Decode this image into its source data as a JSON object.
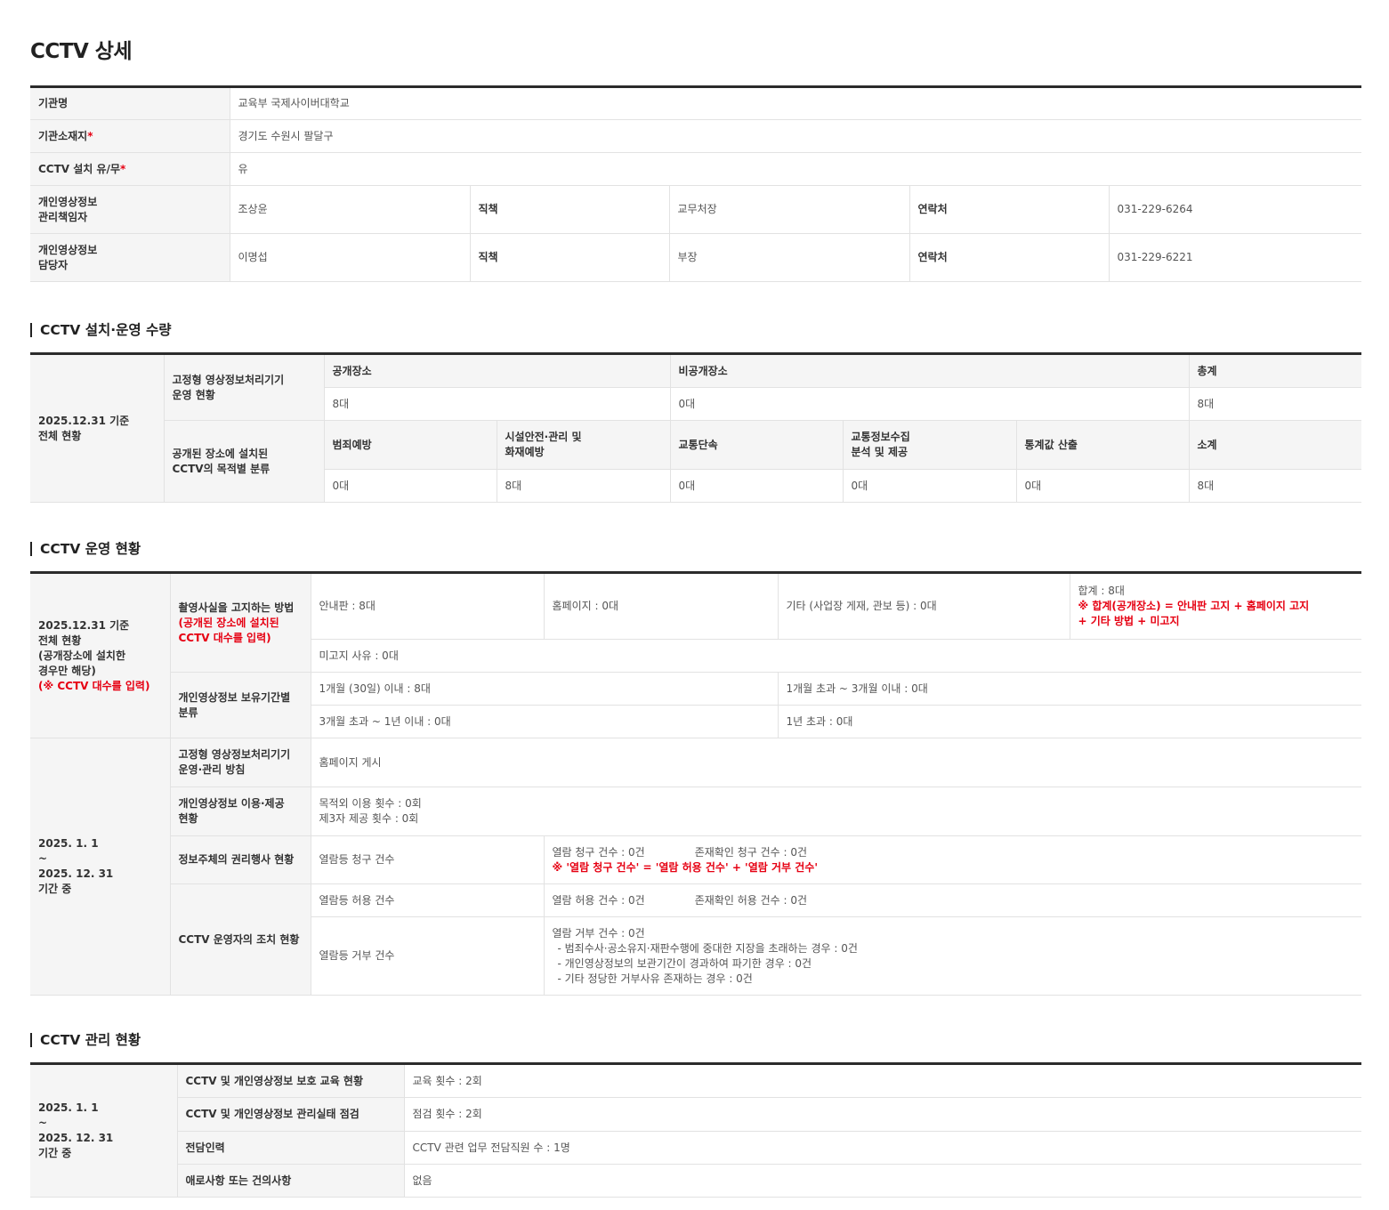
{
  "page_title": "CCTV 상세",
  "basic": {
    "agency_label": "기관명",
    "agency_value": "교육부 국제사이버대학교",
    "location_label": "기관소재지",
    "location_value": "경기도 수원시 팔달구",
    "install_label": "CCTV 설치 유/무",
    "install_value": "유",
    "required_mark": "*",
    "manager_label": [
      "개인영상정보",
      "관리책임자"
    ],
    "manager_name": "조상윤",
    "position_label": "직책",
    "manager_position": "교무처장",
    "contact_label": "연락처",
    "manager_contact": "031-229-6264",
    "staff_label": [
      "개인영상정보",
      "담당자"
    ],
    "staff_name": "이명섭",
    "staff_position": "부장",
    "staff_contact": "031-229-6221"
  },
  "install": {
    "section_title": "CCTV 설치·운영 수량",
    "date_label": [
      "2025.12.31 기준",
      "전체 현황"
    ],
    "fixed_label": [
      "고정형 영상정보처리기기",
      "운영 현황"
    ],
    "public_label": "공개장소",
    "nonpublic_label": "비공개장소",
    "total_label": "총계",
    "public_value": "8대",
    "nonpublic_value": "0대",
    "total_value": "8대",
    "purpose_label": [
      "공개된 장소에 설치된",
      "CCTV의 목적별 분류"
    ],
    "purposes": [
      {
        "label": [
          "범죄예방"
        ],
        "value": "0대"
      },
      {
        "label": [
          "시설안전·관리 및",
          "화재예방"
        ],
        "value": "8대"
      },
      {
        "label": [
          "교통단속"
        ],
        "value": "0대"
      },
      {
        "label": [
          "교통정보수집",
          "분석 및 제공"
        ],
        "value": "0대"
      },
      {
        "label": [
          "통계값 산출"
        ],
        "value": "0대"
      },
      {
        "label": [
          "소계"
        ],
        "value": "8대"
      }
    ]
  },
  "operation": {
    "section_title": "CCTV 운영 현황",
    "date1_label": [
      "2025.12.31 기준",
      "전체 현황",
      "(공개장소에 설치한",
      "경우만 해당)"
    ],
    "date1_note": "(※ CCTV 대수를 입력)",
    "notify_label": "촬영사실을 고지하는 방법",
    "notify_note": [
      "(공개된 장소에 설치된",
      "CCTV 대수를 입력)"
    ],
    "notify_sign": "안내판 : 8대",
    "notify_homepage": "홈페이지 : 0대",
    "notify_other": "기타 (사업장 게재, 관보 등) : 0대",
    "notify_total": "합계 : 8대",
    "notify_total_note": [
      "※ 합계(공개장소) = 안내판 고지 + 홈페이지 고지",
      "+ 기타 방법 + 미고지"
    ],
    "notify_reason": "미고지 사유 : 0대",
    "retention_label": [
      "개인영상정보 보유기간별",
      "분류"
    ],
    "retention_1m": "1개월 (30일) 이내 : 8대",
    "retention_1to3m": "1개월 초과 ~ 3개월 이내 : 0대",
    "retention_3mto1y": "3개월 초과 ~ 1년 이내 : 0대",
    "retention_over1y": "1년 초과 : 0대",
    "date2_label": [
      "2025. 1. 1",
      "~",
      "2025. 12. 31",
      "기간 중"
    ],
    "policy_label": [
      "고정형 영상정보처리기기",
      "운영·관리 방침"
    ],
    "policy_value": "홈페이지 게시",
    "use_label": [
      "개인영상정보 이용·제공",
      "현황"
    ],
    "use_value": [
      "목적외 이용 횟수 : 0회",
      "제3자 제공 횟수 : 0회"
    ],
    "rights_label": "정보주체의 권리행사 현황",
    "rights_request_label": "열람등 청구 건수",
    "rights_view_request": "열람 청구 건수 : 0건",
    "rights_exist_request": "존재확인 청구 건수 : 0건",
    "rights_note": "※ '열람 청구 건수' = '열람 허용 건수' + '열람 거부 건수'",
    "action_label": "CCTV 운영자의 조치 현황",
    "allow_label": "열람등 허용 건수",
    "allow_view": "열람 허용 건수 : 0건",
    "allow_exist": "존재확인 허용 건수 : 0건",
    "deny_label": "열람등 거부 건수",
    "deny_total": "열람 거부 건수 : 0건",
    "deny_items": [
      "- 범죄수사·공소유지·재판수행에 중대한 지장을 초래하는 경우 : 0건",
      "- 개인영상정보의 보관기간이 경과하여 파기한 경우 : 0건",
      "- 기타 정당한 거부사유 존재하는 경우 : 0건"
    ]
  },
  "management": {
    "section_title": "CCTV 관리 현황",
    "date_label": [
      "2025. 1. 1",
      "~",
      "2025. 12. 31",
      "기간 중"
    ],
    "rows": [
      {
        "label": "CCTV 및 개인영상정보 보호 교육 현황",
        "value": "교육 횟수 : 2회"
      },
      {
        "label": "CCTV 및 개인영상정보 관리실태 점검",
        "value": "점검 횟수 : 2회"
      },
      {
        "label": "전담인력",
        "value": "CCTV 관련 업무 전담직원 수 : 1명"
      },
      {
        "label": "애로사항 또는 건의사항",
        "value": "없음"
      }
    ]
  }
}
